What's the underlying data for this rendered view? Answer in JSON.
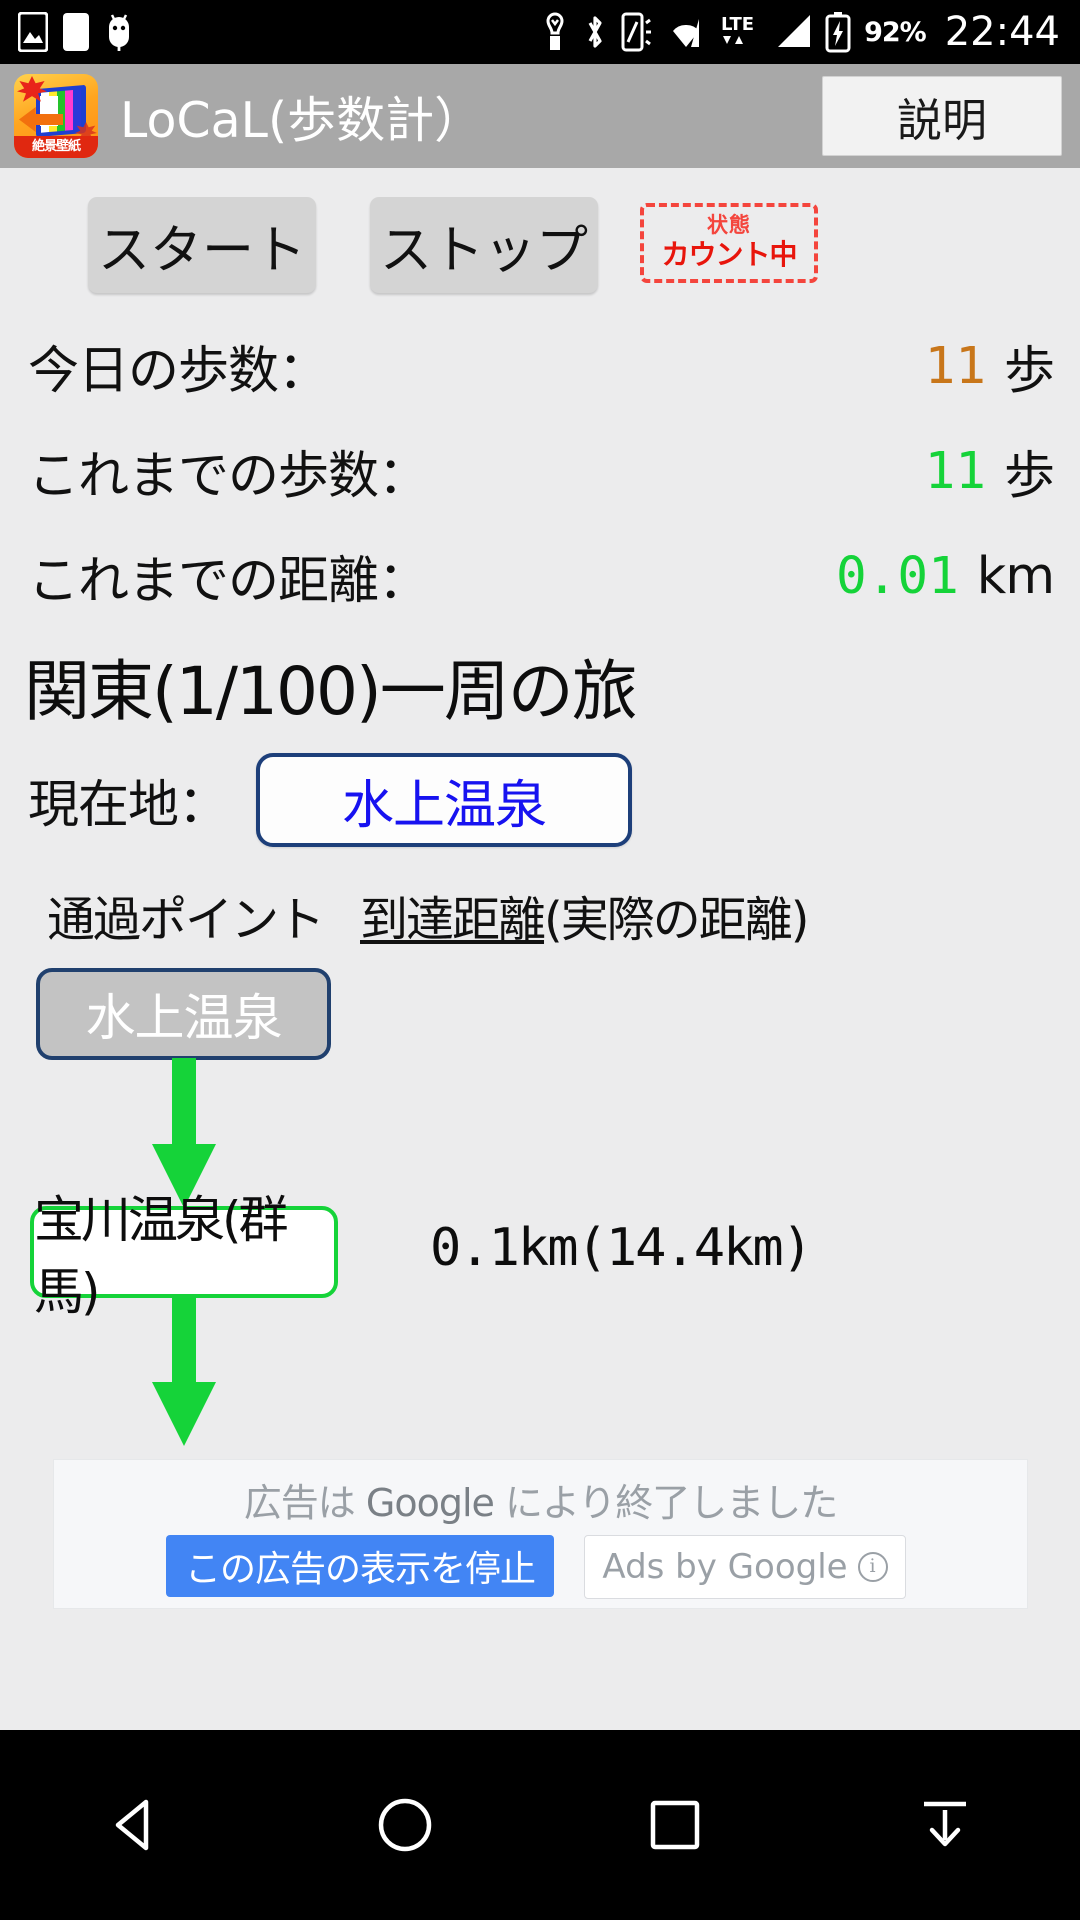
{
  "status_bar": {
    "icons_left": [
      "screenshot-icon",
      "blank-note-icon",
      "android-debug-icon"
    ],
    "icons_right": [
      "vibrate-icon",
      "bluetooth-icon",
      "silent-phone-icon",
      "wifi-icon",
      "lte-icon",
      "signal-icon",
      "battery-charging-icon"
    ],
    "battery_percent": "92%",
    "clock": "22:44"
  },
  "action_bar": {
    "app_icon_badge": "秋",
    "app_icon_banner": "絶景壁紙",
    "title": "LoCaL(歩数計）",
    "help_label": "説明"
  },
  "controls": {
    "start_label": "スタート",
    "stop_label": "ストップ",
    "stamp_top": "状態",
    "stamp_main": "カウント中",
    "stamp_color": "#f4453d"
  },
  "stats": [
    {
      "label": "今日の歩数：",
      "value": "11",
      "unit": "歩",
      "value_color": "#c8761a"
    },
    {
      "label": "これまでの歩数：",
      "value": "11",
      "unit": "歩",
      "value_color": "#15d339"
    },
    {
      "label": "これまでの距離：",
      "value": "0.01",
      "unit": "km",
      "value_color": "#15d339"
    }
  ],
  "journey": {
    "title": "関東(1/100)一周の旅",
    "current_label": "現在地：",
    "current_value": "水上温泉",
    "current_value_color": "#1712f0",
    "header_point": "通過ポイント",
    "header_distance_underlined": "到達距離",
    "header_distance_rest": "(実際の距離)"
  },
  "route": {
    "nodes": [
      {
        "name": "水上温泉",
        "distance": "",
        "style": "current",
        "fill": "#c3c3c3",
        "border": "#20406e",
        "text": "#ffffff"
      },
      {
        "name": "宝川温泉(群馬)",
        "distance": "0.1km(14.4km)",
        "style": "next",
        "fill": "#ffffff",
        "border": "#15d339",
        "text": "#0d0d0d"
      }
    ],
    "arrow_color": "#15d339"
  },
  "ad": {
    "notice_prefix": "広告は ",
    "notice_brand": "Google",
    "notice_suffix": " により終了しました",
    "stop_label": "この広告の表示を停止",
    "by_label": "Ads by Google",
    "info_glyph": "i",
    "button_color": "#4285f4"
  },
  "nav_bar": {
    "back_label": "back-triangle-icon",
    "home_label": "home-circle-icon",
    "recents_label": "recents-square-icon",
    "hide_label": "hide-keyboard-icon"
  }
}
